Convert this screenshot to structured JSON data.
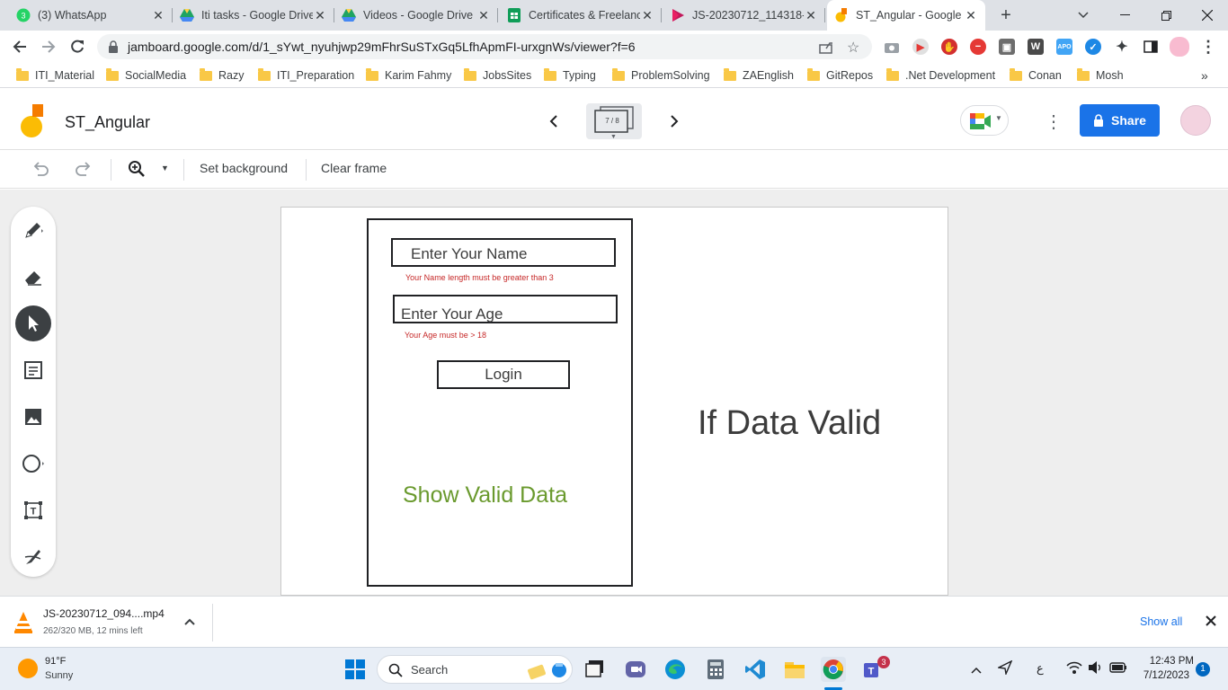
{
  "browser": {
    "tabs": [
      {
        "title": "(3) WhatsApp",
        "icon": "whatsapp-icon"
      },
      {
        "title": "Iti tasks - Google Drive",
        "icon": "google-drive-icon"
      },
      {
        "title": "Videos - Google Drive",
        "icon": "google-drive-icon"
      },
      {
        "title": "Certificates & Freelance",
        "icon": "google-sheets-icon"
      },
      {
        "title": "JS-20230712_114318-",
        "icon": "stream-icon"
      },
      {
        "title": "ST_Angular - Google J",
        "icon": "jamboard-icon",
        "active": true
      }
    ],
    "url": "jamboard.google.com/d/1_sYwt_nyuhjwp29mFhrSuSTxGq5LfhApmFI-urxgnWs/viewer?f=6",
    "bookmarks": [
      "ITI_Material",
      "SocialMedia",
      "Razy",
      "ITI_Preparation",
      "Karim Fahmy",
      "JobsSites",
      "Typing",
      "ProblemSolving",
      "ZAEnglish",
      "GitRepos",
      ".Net Development",
      "Conan",
      "Mosh"
    ]
  },
  "jamboard": {
    "title": "ST_Angular",
    "frame_indicator": "7 / 8",
    "share_label": "Share",
    "toolbar": {
      "set_background": "Set background",
      "clear_frame": "Clear frame"
    }
  },
  "canvas": {
    "name_field": "Enter Your Name",
    "name_error": "Your Name length must be greater than 3",
    "age_field": "Enter Your Age",
    "age_error": "Your Age must be > 18",
    "login_button": "Login",
    "valid_text": "Show Valid Data",
    "if_text": "If Data Valid",
    "colors": {
      "error": "#c62828",
      "valid": "#6a9a2e",
      "heading": "#3c3c3c"
    }
  },
  "download": {
    "filename": "JS-20230712_094....mp4",
    "status": "262/320 MB, 12 mins left",
    "show_all": "Show all"
  },
  "taskbar": {
    "weather_temp": "91°F",
    "weather_desc": "Sunny",
    "search_placeholder": "Search",
    "teams_badge": "3",
    "language": "ع",
    "time": "12:43 PM",
    "date": "7/12/2023",
    "notification_count": "1"
  }
}
